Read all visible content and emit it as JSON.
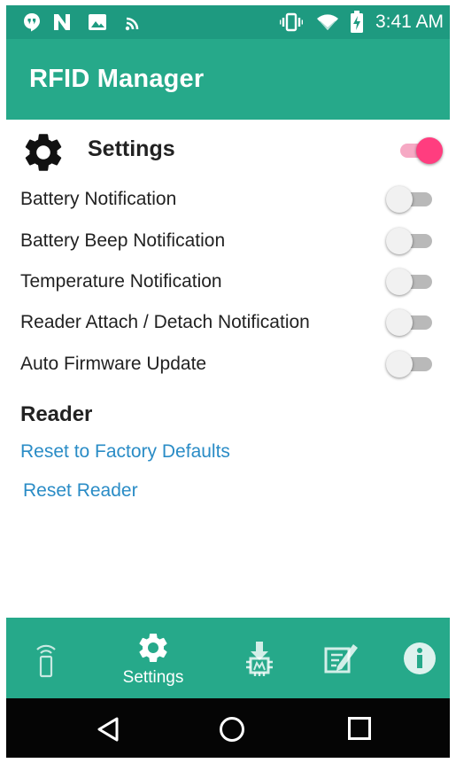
{
  "status_bar": {
    "time": "3:41 AM",
    "icons": [
      "hangouts-icon",
      "n-icon",
      "image-icon",
      "cast-icon",
      "vibrate-icon",
      "wifi-icon",
      "battery-charging-icon"
    ]
  },
  "app_bar": {
    "title": "RFID Manager"
  },
  "settings": {
    "title": "Settings",
    "master_enabled": true,
    "items": [
      {
        "label": "Battery Notification",
        "enabled": false
      },
      {
        "label": "Battery Beep Notification",
        "enabled": false
      },
      {
        "label": "Temperature Notification",
        "enabled": false
      },
      {
        "label": "Reader Attach / Detach Notification",
        "enabled": false
      },
      {
        "label": "Auto Firmware Update",
        "enabled": false
      }
    ]
  },
  "reader": {
    "title": "Reader",
    "links": [
      "Reset to Factory Defaults",
      "Reset Reader"
    ]
  },
  "bottom_nav": {
    "items": [
      {
        "icon": "rfid-reader-icon",
        "label": ""
      },
      {
        "icon": "gear-icon",
        "label": "Settings",
        "active": true
      },
      {
        "icon": "firmware-download-icon",
        "label": ""
      },
      {
        "icon": "edit-icon",
        "label": ""
      },
      {
        "icon": "info-icon",
        "label": ""
      }
    ]
  },
  "colors": {
    "primary": "#26a98a",
    "primary_dark": "#1e9a80",
    "accent": "#ff3d7f",
    "link": "#2a8cc6"
  }
}
